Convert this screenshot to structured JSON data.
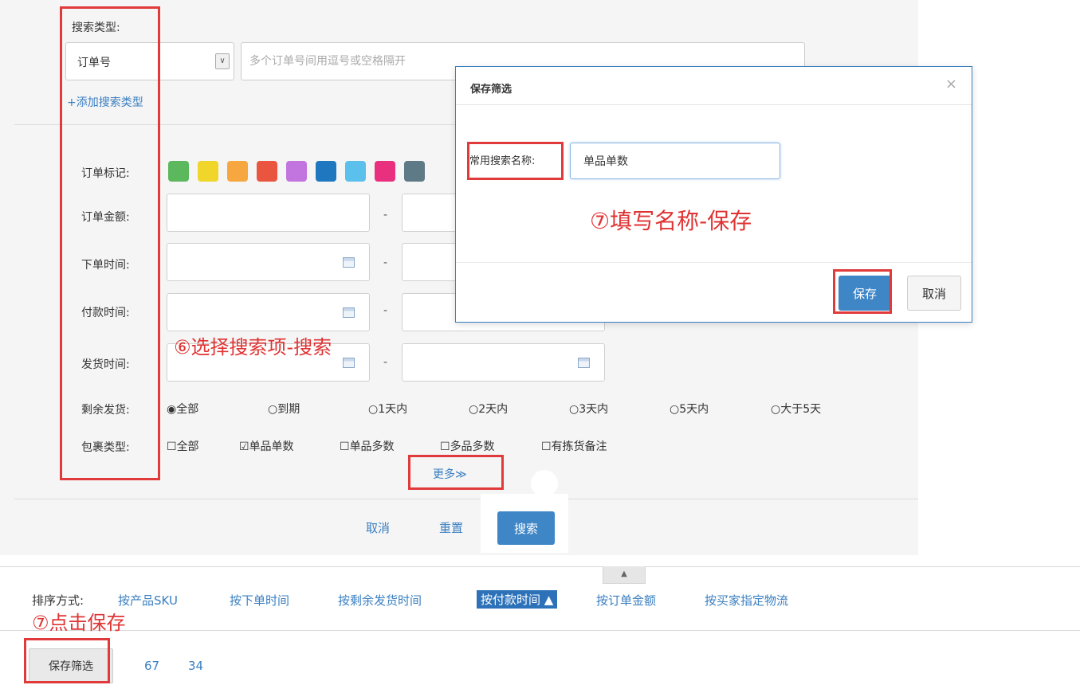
{
  "search": {
    "type_label": "搜索类型:",
    "type_selected": "订单号",
    "type_arrow": "∨",
    "input_placeholder": "多个订单号间用逗号或空格隔开",
    "add_type_link": "+添加搜索类型"
  },
  "filters": {
    "mark_label": "订单标记:",
    "mark_colors": [
      "#5cb85c",
      "#f0d62a",
      "#f6a73f",
      "#e9553f",
      "#c275de",
      "#1f77c0",
      "#5bc0eb",
      "#e8307e",
      "#5f7a87"
    ],
    "amount_label": "订单金额:",
    "order_time_label": "下单时间:",
    "pay_time_label": "付款时间:",
    "ship_time_label": "发货时间:",
    "range_separator": "-",
    "remaining_label": "剩余发货:",
    "remaining_options": [
      {
        "mark": "◉",
        "label": "全部"
      },
      {
        "mark": "○",
        "label": "到期"
      },
      {
        "mark": "○",
        "label": "1天内"
      },
      {
        "mark": "○",
        "label": "2天内"
      },
      {
        "mark": "○",
        "label": "3天内"
      },
      {
        "mark": "○",
        "label": "5天内"
      },
      {
        "mark": "○",
        "label": "大于5天"
      }
    ],
    "package_label": "包裹类型:",
    "package_options": [
      {
        "mark": "☐",
        "label": "全部"
      },
      {
        "mark": "☑",
        "label": "单品单数"
      },
      {
        "mark": "☐",
        "label": "单品多数"
      },
      {
        "mark": "☐",
        "label": "多品多数"
      },
      {
        "mark": "☐",
        "label": "有拣货备注"
      }
    ],
    "more_link": "更多≫"
  },
  "actions": {
    "cancel": "取消",
    "reset": "重置",
    "search": "搜索"
  },
  "collapse_glyph": "▲",
  "sort": {
    "label": "排序方式:",
    "options": [
      "按产品SKU",
      "按下单时间",
      "按剩余发货时间",
      "按付款时间 ▲",
      "按订单金额",
      "按买家指定物流"
    ]
  },
  "bottom": {
    "save_filter": "保存筛选",
    "pages": [
      "67",
      "34"
    ]
  },
  "annotations": {
    "step6": "⑥选择搜索项-搜索",
    "step7_fill": "⑦填写名称-保存",
    "step7_click": "⑦点击保存"
  },
  "modal": {
    "title": "保存筛选",
    "close": "×",
    "name_label": "常用搜索名称:",
    "name_value": "单品单数",
    "save": "保存",
    "cancel": "取消"
  }
}
